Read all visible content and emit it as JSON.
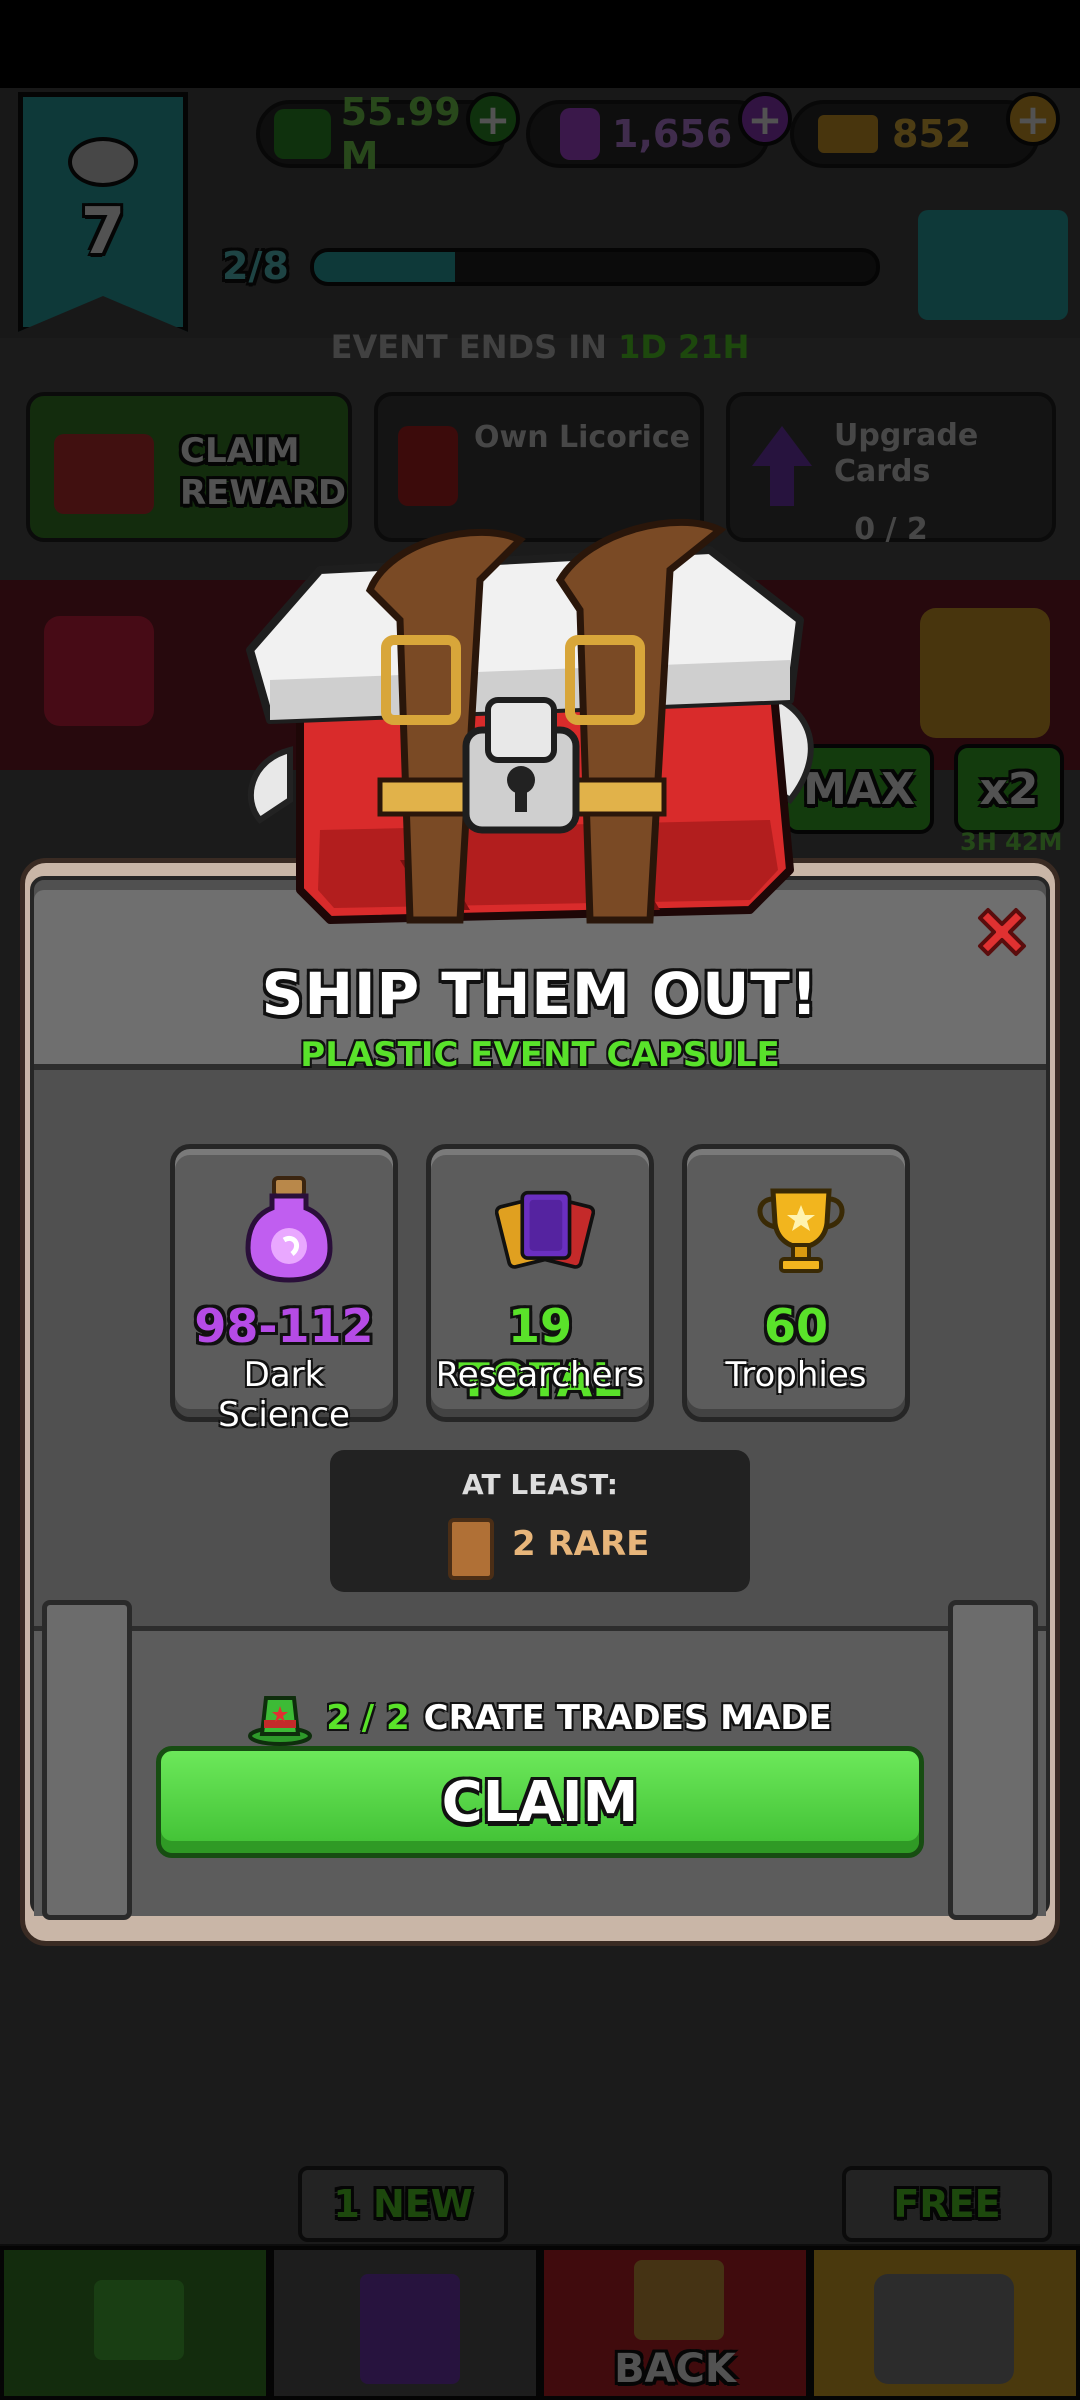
{
  "hud": {
    "level": "7",
    "currency_tophat": "55.99 M",
    "currency_potion": "1,656",
    "currency_gold": "852",
    "progress": "2/8",
    "progress_fraction": 0.25,
    "event_ends_label": "EVENT ENDS IN",
    "event_ends_time": "1D 21H"
  },
  "tasks": {
    "claim_reward": "CLAIM REWARD",
    "own_licorice": "Own Licorice",
    "upgrade_cards": "Upgrade Cards",
    "upgrade_progress": "0 / 2"
  },
  "background_buttons": {
    "max": "MAX",
    "x2": "x2",
    "timer": "3H 42M"
  },
  "modal": {
    "title": "SHIP THEM OUT!",
    "subtitle": "PLASTIC EVENT CAPSULE",
    "rewards": [
      {
        "value": "98-112",
        "label": "Dark Science",
        "color": "#b54be6",
        "icon": "potion-icon"
      },
      {
        "value": "19 TOTAL",
        "label": "Researchers",
        "color": "#5ae22a",
        "icon": "cards-icon"
      },
      {
        "value": "60",
        "label": "Trophies",
        "color": "#5ae22a",
        "icon": "trophy-icon"
      }
    ],
    "at_least_label": "AT LEAST:",
    "rare_text": "2 RARE",
    "trades_count": "2 / 2",
    "trades_text": "CRATE TRADES MADE",
    "claim_label": "CLAIM"
  },
  "bottom_nav": {
    "new_tag": "1 NEW",
    "free_tag": "FREE",
    "back_label": "BACK"
  },
  "colors": {
    "accent_green": "#5ae22a",
    "purple": "#b54be6",
    "close_red": "#e03131",
    "rare_orange": "#e7b57a"
  }
}
